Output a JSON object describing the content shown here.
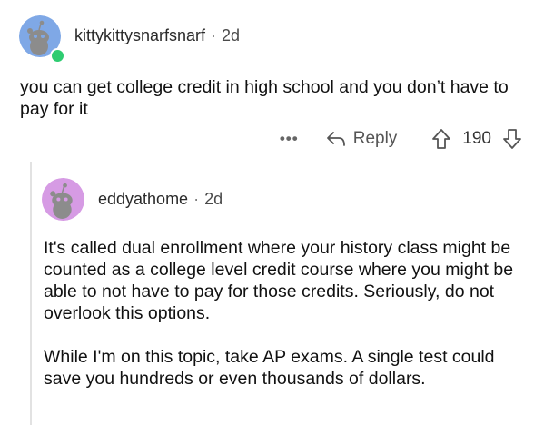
{
  "top_comment": {
    "username": "kittykittysnarfsnarf",
    "separator": "·",
    "age": "2d",
    "body": "you can get college credit in high school and you don’t have to pay for it",
    "actions": {
      "more": "•••",
      "reply_label": "Reply",
      "vote_count": "190"
    }
  },
  "reply_comment": {
    "username": "eddyathome",
    "separator": "·",
    "age": "2d",
    "paragraphs": [
      "It's called dual enrollment where your history class might be counted as a college level credit course where you might be able to not have to pay for those credits.  Seriously, do not overlook this options.",
      "While I'm on this topic, take AP exams.  A single test could save you hundreds or even thousands of dollars."
    ]
  },
  "colors": {
    "avatar_blue": "#7fa8e6",
    "avatar_purple": "#d69be4",
    "online": "#2ecc71"
  }
}
